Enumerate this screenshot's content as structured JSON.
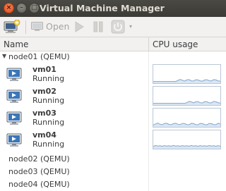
{
  "window": {
    "title": "Virtual Machine Manager"
  },
  "titlebar": {
    "close_glyph": "×",
    "min_glyph": "–",
    "max_glyph": "□"
  },
  "toolbar": {
    "new_icon": "computer-add-icon",
    "open_label": "Open",
    "open_icon": "monitor-icon",
    "run_icon": "play-icon",
    "pause_icon": "pause-icon",
    "shutdown_icon": "power-icon",
    "dropdown_glyph": "▾"
  },
  "columns": {
    "name": "Name",
    "cpu": "CPU usage"
  },
  "connections": [
    {
      "label": "node01 (QEMU)",
      "expanded": true,
      "expander_glyph": "▼"
    },
    {
      "label": "node02 (QEMU)",
      "expanded": false
    },
    {
      "label": "node03 (QEMU)",
      "expanded": false
    },
    {
      "label": "node04 (QEMU)",
      "expanded": false
    }
  ],
  "vms": [
    {
      "name": "vm01",
      "status": "Running",
      "cpu": [
        0.02,
        0.02,
        0.02,
        0.02,
        0.02,
        0.02,
        0.02,
        0.02,
        0.02,
        0.02,
        0.02,
        0.08,
        0.15,
        0.1,
        0.04,
        0.12,
        0.14,
        0.06,
        0.05,
        0.13,
        0.12,
        0.06,
        0.04,
        0.12,
        0.13,
        0.07,
        0.05,
        0.14,
        0.12,
        0.06,
        0.04
      ]
    },
    {
      "name": "vm02",
      "status": "Running",
      "cpu": [
        0.02,
        0.02,
        0.02,
        0.02,
        0.02,
        0.02,
        0.02,
        0.02,
        0.02,
        0.02,
        0.02,
        0.02,
        0.02,
        0.02,
        0.02,
        0.06,
        0.14,
        0.12,
        0.05,
        0.12,
        0.13,
        0.06,
        0.04,
        0.13,
        0.12,
        0.05,
        0.05,
        0.14,
        0.12,
        0.06,
        0.04
      ]
    },
    {
      "name": "vm03",
      "status": "Running",
      "cpu": [
        0.03,
        0.1,
        0.15,
        0.08,
        0.05,
        0.13,
        0.14,
        0.07,
        0.05,
        0.12,
        0.14,
        0.08,
        0.05,
        0.13,
        0.12,
        0.06,
        0.05,
        0.14,
        0.12,
        0.06,
        0.05,
        0.13,
        0.12,
        0.06,
        0.04,
        0.13,
        0.12,
        0.06,
        0.05,
        0.14,
        0.1
      ]
    },
    {
      "name": "vm04",
      "status": "Running",
      "cpu": [
        0.06,
        0.12,
        0.08,
        0.1,
        0.07,
        0.11,
        0.08,
        0.1,
        0.07,
        0.12,
        0.08,
        0.1,
        0.07,
        0.11,
        0.08,
        0.1,
        0.07,
        0.12,
        0.08,
        0.1,
        0.07,
        0.11,
        0.08,
        0.1,
        0.07,
        0.12,
        0.08,
        0.1,
        0.07,
        0.11,
        0.08
      ]
    }
  ],
  "colors": {
    "graph_line": "#7fa7cf",
    "graph_fill": "#dbe6f2",
    "graph_border": "#b9c7d6",
    "titlebar": "#3c3b37"
  }
}
